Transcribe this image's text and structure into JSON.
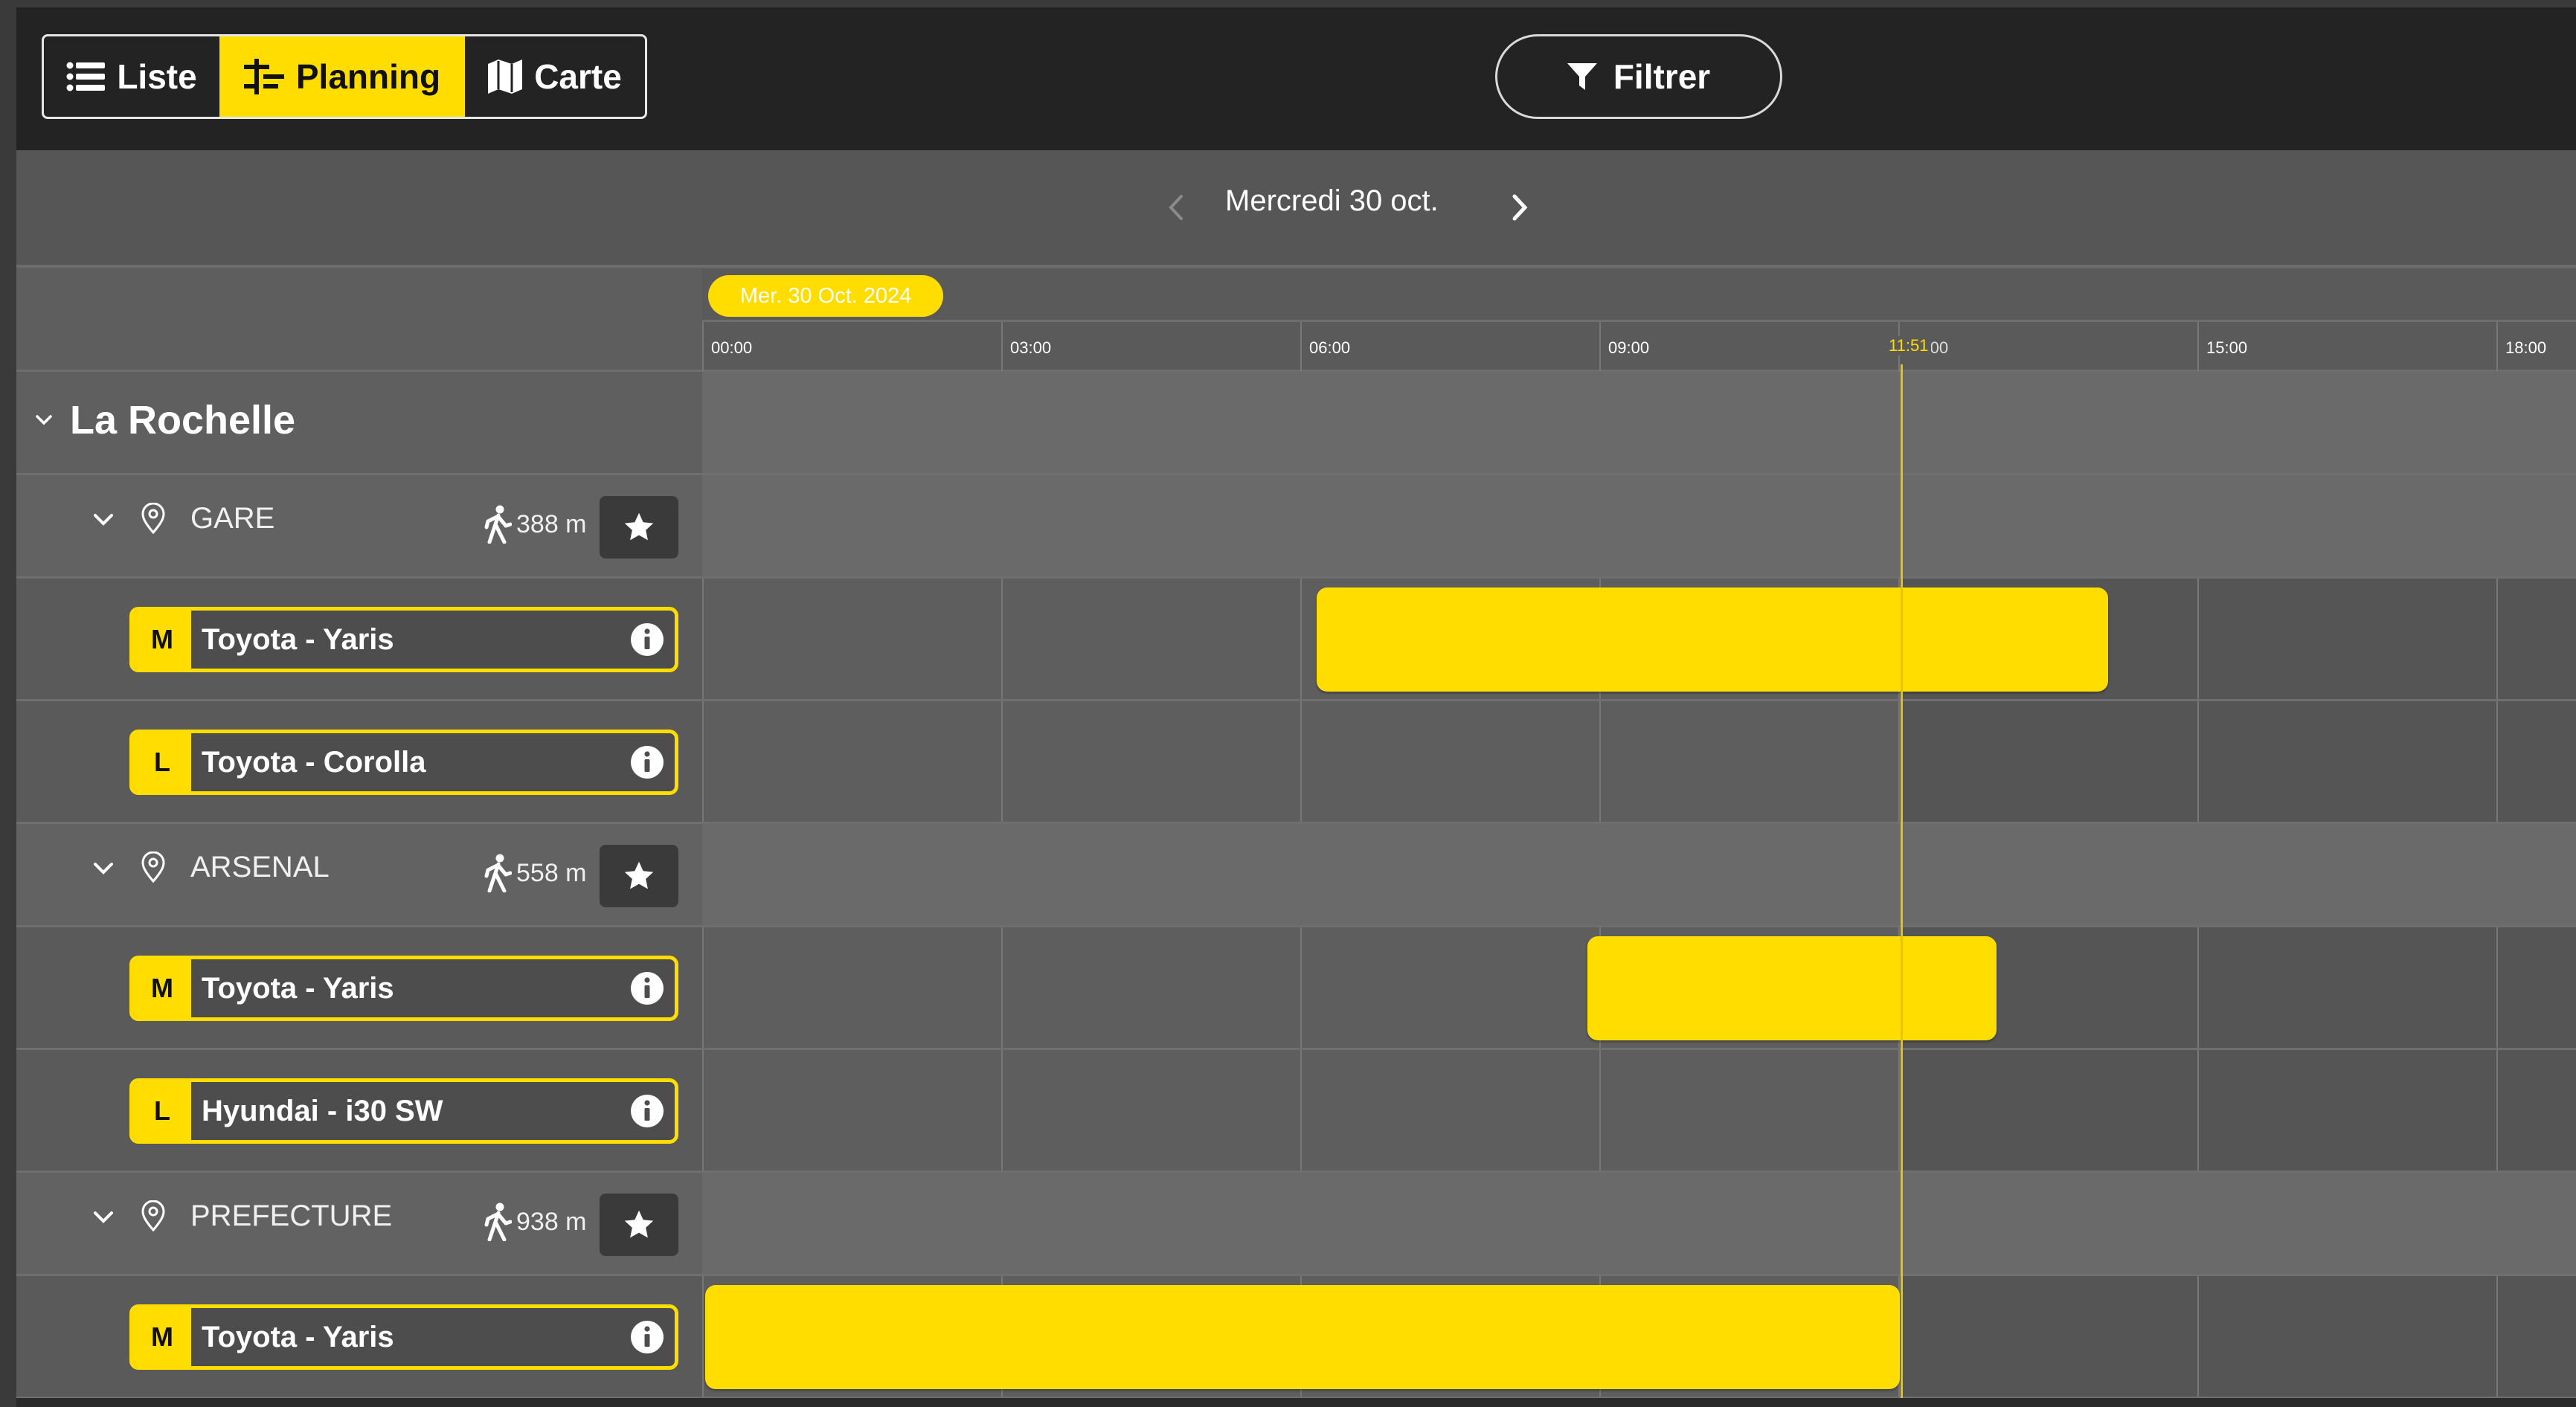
{
  "toolbar": {
    "tabs": [
      {
        "label": "Liste",
        "icon": "list-icon"
      },
      {
        "label": "Planning",
        "icon": "planning-icon",
        "active": true
      },
      {
        "label": "Carte",
        "icon": "map-icon"
      }
    ],
    "filter_label": "Filtrer"
  },
  "date_nav": {
    "label": "Mercredi 30 oct."
  },
  "timeline": {
    "date_pill": "Mer. 30 Oct. 2024",
    "ticks": [
      "00:00",
      "03:00",
      "06:00",
      "09:00",
      "12:00",
      "15:00",
      "18:00"
    ],
    "now_label": "11:51",
    "now_time": "11:51"
  },
  "city": {
    "name": "La Rochelle"
  },
  "stations": [
    {
      "name": "GARE",
      "distance": "388 m",
      "cars": [
        {
          "size": "M",
          "name": "Toyota - Yaris",
          "bookings": [
            {
              "start": "06:00",
              "end": "13:55"
            }
          ]
        },
        {
          "size": "L",
          "name": "Toyota - Corolla",
          "bookings": []
        }
      ]
    },
    {
      "name": "ARSENAL",
      "distance": "558 m",
      "cars": [
        {
          "size": "M",
          "name": "Toyota - Yaris",
          "bookings": [
            {
              "start": "08:45",
              "end": "12:50"
            }
          ]
        },
        {
          "size": "L",
          "name": "Hyundai - i30 SW",
          "bookings": []
        }
      ]
    },
    {
      "name": "PREFECTURE",
      "distance": "938 m",
      "cars": [
        {
          "size": "M",
          "name": "Toyota - Yaris",
          "bookings": [
            {
              "start": "00:00",
              "end": "12:00"
            }
          ]
        }
      ]
    }
  ],
  "colors": {
    "accent": "#ffdd00",
    "toolbar_bg": "#232323",
    "panel_bg": "#5f5f5f"
  }
}
